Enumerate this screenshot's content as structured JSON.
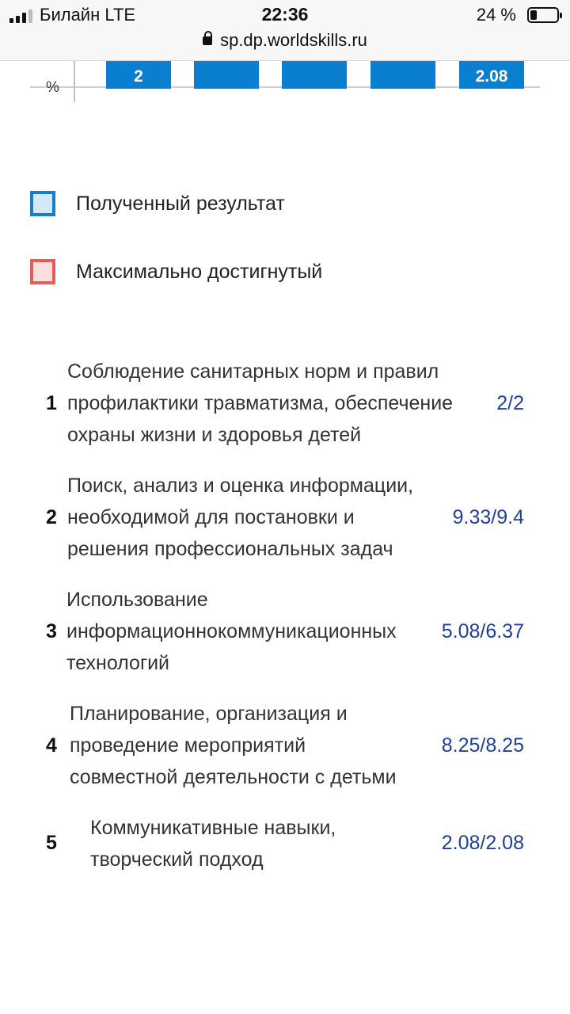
{
  "status_bar": {
    "carrier": "Билайн  LTE",
    "time": "22:36",
    "battery_percent": "24 %",
    "battery_level": 0.24,
    "url": "sp.dp.worldskills.ru"
  },
  "chart": {
    "axis_unit_label": "%",
    "bar_color": "#0a7fd0",
    "bar_labels": [
      "2",
      "",
      "",
      "",
      "2.08"
    ]
  },
  "legend": [
    {
      "label": "Полученный результат",
      "border": "#1b7dc6",
      "fill": "#d3e9f8"
    },
    {
      "label": "Максимально достигнутый",
      "border": "#e55c5c",
      "fill": "#fbe0e0"
    }
  ],
  "criteria": [
    {
      "num": "1",
      "lines": [
        "Соблюдение санитарных норм и правил",
        "профилактики травматизма, обеспечение",
        "охраны жизни и здоровья детей"
      ],
      "score": "2/2"
    },
    {
      "num": "2",
      "lines": [
        "Поиск, анализ и оценка информации,",
        "необходимой для постановки и",
        "решения профессиональных задач"
      ],
      "score": "9.33/9.4"
    },
    {
      "num": "3",
      "lines": [
        "Использование",
        "информационнокоммуникационных",
        "технологий"
      ],
      "score": "5.08/6.37"
    },
    {
      "num": "4",
      "lines": [
        "Планирование, организация и",
        "проведение мероприятий",
        "совместной деятельности с детьми"
      ],
      "score": "8.25/8.25"
    },
    {
      "num": "5",
      "lines": [
        "Коммуникативные навыки,",
        "творческий подход"
      ],
      "score": "2.08/2.08"
    }
  ]
}
